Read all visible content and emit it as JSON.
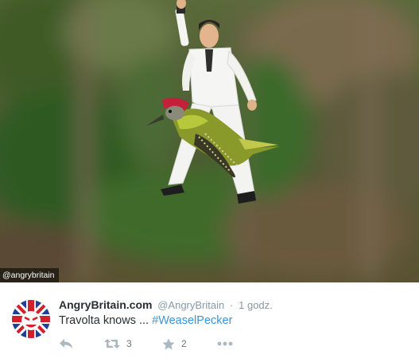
{
  "media": {
    "watermark": "@angrybritain",
    "description_icon": "photo"
  },
  "tweet": {
    "fullname": "AngryBritain.com",
    "handle": "@AngryBritain",
    "separator": "·",
    "time": "1 godz.",
    "text": "Travolta knows ... ",
    "hashtag": "#WeaselPecker",
    "avatar_icon": "union-jack-angry-face-avatar",
    "actions": {
      "reply_icon": "reply-icon",
      "retweet_icon": "retweet-icon",
      "retweet_count": "3",
      "favorite_icon": "star-icon",
      "favorite_count": "2",
      "more_icon": "more-dots-icon"
    }
  },
  "colors": {
    "link": "#3b94d9",
    "name": "#292f33",
    "meta": "#8899a6",
    "union_blue": "#1f3f9a",
    "union_red": "#d21f2b"
  }
}
